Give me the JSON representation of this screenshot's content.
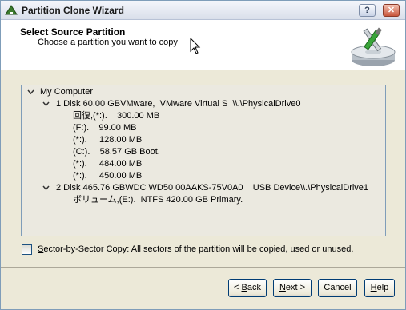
{
  "window": {
    "title": "Partition Clone Wizard",
    "help_glyph": "?",
    "close_glyph": "✕"
  },
  "header": {
    "title": "Select Source Partition",
    "subtitle": "Choose a partition you want to copy"
  },
  "tree": {
    "root": "My Computer",
    "disks": [
      {
        "label": "1 Disk 60.00 GBVMware,  VMware Virtual S  \\\\.\\PhysicalDrive0",
        "partitions": [
          "回復,(*:).    300.00 MB",
          "(F:).    99.00 MB",
          "(*:).     128.00 MB",
          "(C:).    58.57 GB Boot.",
          "(*:).     484.00 MB",
          "(*:).     450.00 MB"
        ]
      },
      {
        "label": "2 Disk 465.76 GBWDC WD50 00AAKS-75V0A0    USB Device\\\\.\\PhysicalDrive1",
        "partitions": [
          "ボリューム,(E:).  NTFS 420.00 GB Primary."
        ]
      }
    ]
  },
  "options": {
    "sector_label_u": "S",
    "sector_label_rest": "ector-by-Sector Copy: All sectors of the partition will be copied, used or unused.",
    "sector_checked": false
  },
  "buttons": {
    "back_prefix": "< ",
    "back_u": "B",
    "back_rest": "ack",
    "next_u": "N",
    "next_rest": "ext >",
    "cancel": "Cancel",
    "help_u": "H",
    "help_rest": "elp"
  }
}
